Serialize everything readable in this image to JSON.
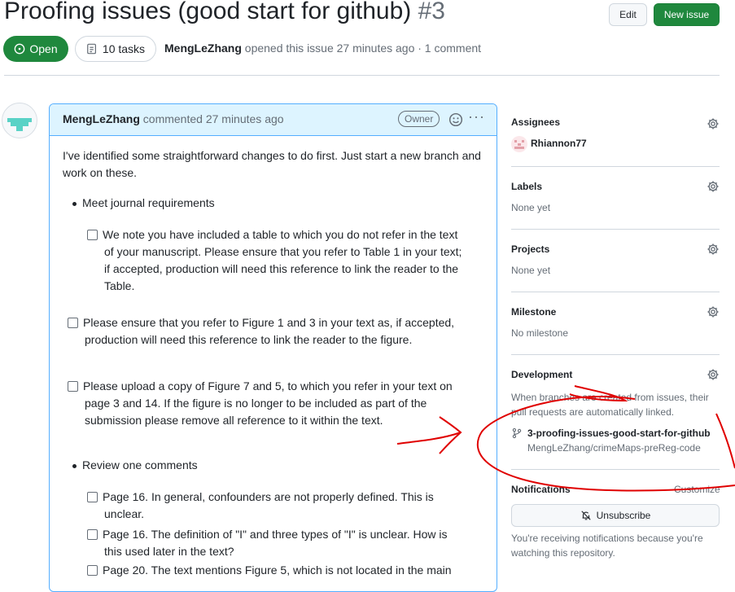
{
  "issue": {
    "title": "Proofing issues (good start for github)",
    "number": "#3",
    "state": "Open",
    "tasks": "10 tasks",
    "author": "MengLeZhang",
    "meta_text": "opened this issue 27 minutes ago · 1 comment"
  },
  "header_buttons": {
    "edit": "Edit",
    "new_issue": "New issue"
  },
  "comment": {
    "author": "MengLeZhang",
    "action": "commented 27 minutes ago",
    "role_badge": "Owner",
    "intro_line1": "I've identified some straightforward changes to do first. Just start a new branch and",
    "intro_line2": "work on these.",
    "bullet1": "Meet journal requirements",
    "task1": [
      "We note you have included a table to which you do not refer in the text",
      "of your manuscript. Please ensure that you refer to Table 1 in your text;",
      "if accepted, production will need this reference to link the reader to the",
      "Table."
    ],
    "task2": [
      "Please ensure that you refer to Figure 1 and 3 in your text as, if accepted,",
      "production will need this reference to link the reader to the figure."
    ],
    "task3": [
      "Please upload a copy of Figure 7 and 5, to which you refer in your text on",
      "page 3 and 14. If the figure is no longer to be included as part of the",
      "submission please remove all reference to it within the text."
    ],
    "bullet2": "Review one comments",
    "task4": [
      "Page 16. In general, confounders are not properly defined. This is",
      "unclear."
    ],
    "task5": [
      "Page 16. The definition of \"I\" and three types of \"I\" is unclear. How is",
      "this used later in the text?"
    ],
    "task6": [
      "Page 20. The text mentions Figure 5, which is not located in the main"
    ]
  },
  "sidebar": {
    "assignees": {
      "label": "Assignees",
      "user": "Rhiannon77"
    },
    "labels": {
      "label": "Labels",
      "value": "None yet"
    },
    "projects": {
      "label": "Projects",
      "value": "None yet"
    },
    "milestone": {
      "label": "Milestone",
      "value": "No milestone"
    },
    "development": {
      "label": "Development",
      "note_line1": "When branches are created from issues, their",
      "note_line2": "pull requests are automatically linked.",
      "branch": "3-proofing-issues-good-start-for-github",
      "repo": "MengLeZhang/crimeMaps-preReg-code"
    },
    "notifications": {
      "label": "Notifications",
      "customize": "Customize",
      "button": "Unsubscribe",
      "note_line1": "You're receiving notifications because you're",
      "note_line2": "watching this repository."
    }
  },
  "colors": {
    "open_green": "#1f883d",
    "annotation_red": "#e00000",
    "comment_border": "#54aeff"
  },
  "icons": [
    "issue-open-icon",
    "checklist-icon",
    "smiley-icon",
    "kebab-icon",
    "gear-icon",
    "branch-icon",
    "bell-slash-icon"
  ]
}
